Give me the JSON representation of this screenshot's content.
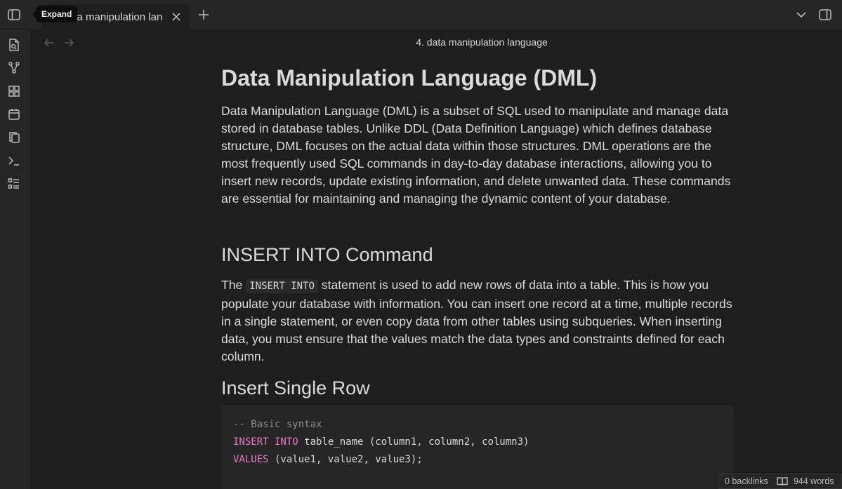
{
  "tabs": [
    {
      "title": "4. data manipulation language"
    }
  ],
  "tooltip": {
    "text": "Expand"
  },
  "view": {
    "title": "4. data manipulation language"
  },
  "document": {
    "h1": "Data Manipulation Language (DML)",
    "p1": "Data Manipulation Language (DML) is a subset of SQL used to manipulate and manage data stored in database tables. Unlike DDL (Data Definition Language) which defines database structure, DML focuses on the actual data within those structures. DML operations are the most frequently used SQL commands in day-to-day database interactions, allowing you to insert new records, update existing information, and delete unwanted data. These commands are essential for maintaining and managing the dynamic content of your database.",
    "h2_insert": "INSERT INTO Command",
    "p2_before": "The ",
    "p2_code": "INSERT INTO",
    "p2_after": " statement is used to add new rows of data into a table. This is how you populate your database with information. You can insert one record at a time, multiple records in a single statement, or even copy data from other tables using subqueries. When inserting data, you must ensure that the values match the data types and constraints defined for each column.",
    "h3_single": "Insert Single Row",
    "code": {
      "comment": "-- Basic syntax",
      "line2_kw": "INSERT INTO",
      "line2_rest": " table_name (column1, column2, column3)",
      "line3_kw": "VALUES",
      "line3_rest": " (value1, value2, value3);"
    }
  },
  "status": {
    "backlinks": "0 backlinks",
    "words": "944 words"
  },
  "ribbon_icons": [
    "open-quick-switcher-icon",
    "graph-view-icon",
    "canvas-icon",
    "daily-notes-icon",
    "templates-icon",
    "command-palette-icon",
    "outline-icon"
  ]
}
